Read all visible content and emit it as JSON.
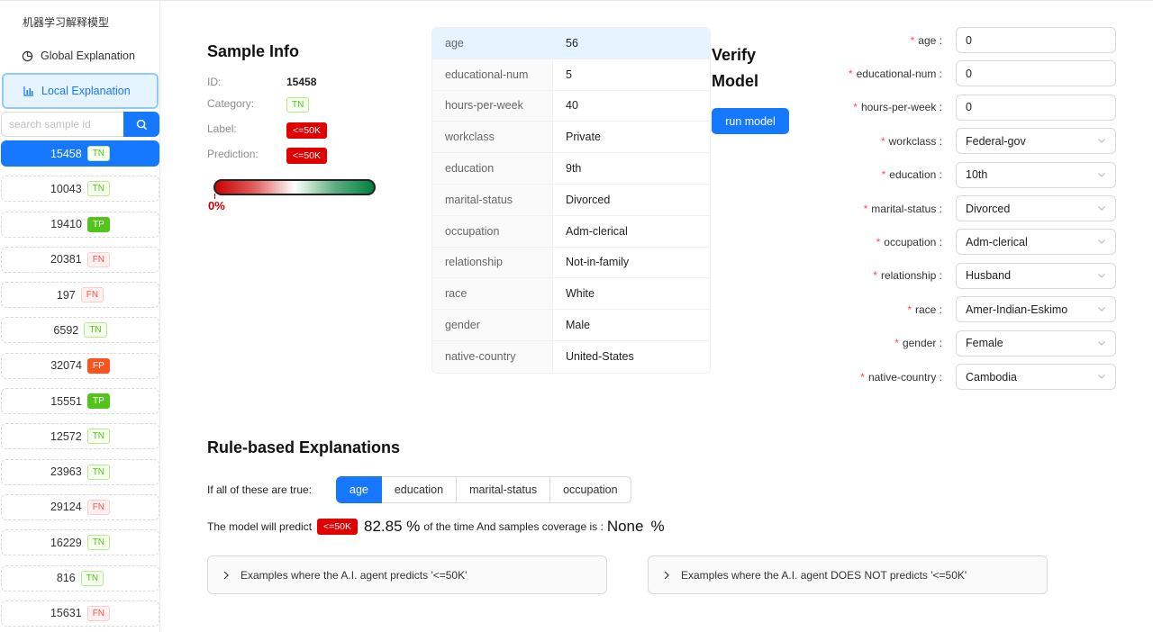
{
  "app": {
    "title": "机器学习解释模型"
  },
  "nav": {
    "global": "Global Explanation",
    "local": "Local Explanation"
  },
  "search": {
    "placeholder": "search sample id"
  },
  "samples": [
    {
      "id": "15458",
      "tag": "TN",
      "active": true
    },
    {
      "id": "10043",
      "tag": "TN"
    },
    {
      "id": "19410",
      "tag": "TP"
    },
    {
      "id": "20381",
      "tag": "FN"
    },
    {
      "id": "197",
      "tag": "FN"
    },
    {
      "id": "6592",
      "tag": "TN"
    },
    {
      "id": "32074",
      "tag": "FP"
    },
    {
      "id": "15551",
      "tag": "TP"
    },
    {
      "id": "12572",
      "tag": "TN"
    },
    {
      "id": "23963",
      "tag": "TN"
    },
    {
      "id": "29124",
      "tag": "FN"
    },
    {
      "id": "16229",
      "tag": "TN"
    },
    {
      "id": "816",
      "tag": "TN"
    },
    {
      "id": "15631",
      "tag": "FN"
    }
  ],
  "sample_info": {
    "title": "Sample Info",
    "id_label": "ID:",
    "id_value": "15458",
    "category_label": "Category:",
    "category_value": "TN",
    "label_label": "Label:",
    "label_value": "<=50K",
    "prediction_label": "Prediction:",
    "prediction_value": "<=50K",
    "probability_text": "0%",
    "probability": 0
  },
  "features": [
    {
      "key": "age",
      "value": "56"
    },
    {
      "key": "educational-num",
      "value": "5"
    },
    {
      "key": "hours-per-week",
      "value": "40"
    },
    {
      "key": "workclass",
      "value": "Private"
    },
    {
      "key": "education",
      "value": "9th"
    },
    {
      "key": "marital-status",
      "value": "Divorced"
    },
    {
      "key": "occupation",
      "value": "Adm-clerical"
    },
    {
      "key": "relationship",
      "value": "Not-in-family"
    },
    {
      "key": "race",
      "value": "White"
    },
    {
      "key": "gender",
      "value": "Male"
    },
    {
      "key": "native-country",
      "value": "United-States"
    }
  ],
  "verify": {
    "title": "Verify Model",
    "run_label": "run model"
  },
  "form": [
    {
      "label": "age",
      "value": "0",
      "type": "input"
    },
    {
      "label": "educational-num",
      "value": "0",
      "type": "input"
    },
    {
      "label": "hours-per-week",
      "value": "0",
      "type": "input"
    },
    {
      "label": "workclass",
      "value": "Federal-gov",
      "type": "select"
    },
    {
      "label": "education",
      "value": "10th",
      "type": "select"
    },
    {
      "label": "marital-status",
      "value": "Divorced",
      "type": "select"
    },
    {
      "label": "occupation",
      "value": "Adm-clerical",
      "type": "select"
    },
    {
      "label": "relationship",
      "value": "Husband",
      "type": "select"
    },
    {
      "label": "race",
      "value": "Amer-Indian-Eskimo",
      "type": "select"
    },
    {
      "label": "gender",
      "value": "Female",
      "type": "select"
    },
    {
      "label": "native-country",
      "value": "Cambodia",
      "type": "select"
    }
  ],
  "rules": {
    "title": "Rule-based Explanations",
    "condition_label": "If all of these are true:",
    "conditions": [
      "age",
      "education",
      "marital-status",
      "occupation"
    ],
    "predict_prefix": "The model will predict",
    "predict_tag": "<=50K",
    "percent": "82.85 %",
    "middle_text": "of the time And samples coverage is :",
    "coverage": "None",
    "coverage_unit": "%",
    "examples_yes": "Examples where the A.I. agent predicts '<=50K'",
    "examples_no": "Examples where the A.I. agent DOES NOT predicts '<=50K'"
  },
  "colors": {
    "primary": "#1677ff",
    "danger": "#e00000",
    "success": "#52c41a",
    "warning": "#fa541c"
  }
}
